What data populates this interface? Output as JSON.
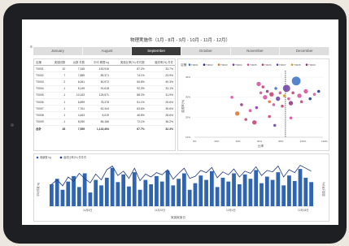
{
  "dashboard": {
    "title": "物理実施件（1月 - 8月 - 9月 - 10月 - 11月 - 12月）",
    "menu_icon": "≡",
    "months": [
      "January",
      "August",
      "September",
      "October",
      "November",
      "December"
    ],
    "active_month": "September"
  },
  "table": {
    "headers": [
      "店舗",
      "実施回数",
      "台数 件数",
      "平均 期間 kg",
      "実施比率(%) 件件数",
      "達成率(%) 件件"
    ],
    "rows": [
      [
        "T0001",
        "10",
        "7,345",
        "153,916",
        "87.2%",
        "33.7%"
      ],
      [
        "T0002",
        "7",
        "7,889",
        "85,371",
        "74.1%",
        "23.9%"
      ],
      [
        "T0003",
        "2",
        "6,061",
        "50,972",
        "50.8%",
        "49.3%"
      ],
      [
        "T0004",
        "1",
        "8,149",
        "91,618",
        "92.3%",
        "33.1%"
      ],
      [
        "T0005",
        "1",
        "10,163",
        "125,571",
        "88.2%",
        "31.9%"
      ],
      [
        "T0006",
        "1",
        "6,899",
        "78,378",
        "51.1%",
        "25.6%"
      ],
      [
        "T0007",
        "1",
        "7,761",
        "62,344",
        "63.6%",
        "35.6%"
      ],
      [
        "T0008",
        "1",
        "4,463",
        "6,019",
        "46.8%",
        "28.6%"
      ],
      [
        "T0009",
        "1",
        "8,090",
        "85,186",
        "72.1%",
        "36.2%"
      ]
    ],
    "total": [
      "合計",
      "48",
      "7,555",
      "1,142,494",
      "67.7%",
      "32.3%"
    ]
  },
  "scatter": {
    "legend_title": "店舗",
    "legend": [
      "T0001",
      "T0002",
      "T0003",
      "T0004",
      "T0005",
      "T0006",
      "T0007",
      "T0008",
      "T0009"
    ],
    "colors": [
      "#3a6fc4",
      "#1f2f7a",
      "#e0702f",
      "#7a3aa8",
      "#d44c9a",
      "#c43a6a",
      "#6a3fa0",
      "#c8a030",
      "#8f2f7a"
    ],
    "xlabel": "比率",
    "ylabel": "達成率(%)",
    "x_ticks": [
      "0%",
      "20%",
      "40%",
      "60%",
      "80%",
      "100%",
      "120%"
    ],
    "y_ticks": [
      "40%",
      "30%",
      "20%",
      "10%"
    ]
  },
  "combo": {
    "legend": [
      "実績数 kg",
      "達成比率(%) 件件件"
    ],
    "left_label": "平均件数 kg",
    "right_label": "達成比率(%)",
    "xlabel": "実施実施日",
    "date_labels": [
      "11月6日",
      "11月20日",
      "12月4日",
      "12月18日"
    ],
    "bar_color": "#2f64b0",
    "line_color": "#223a80"
  },
  "chart_data": [
    {
      "type": "table",
      "title": "",
      "columns": [
        "店舗",
        "実施回数",
        "台数 件数",
        "平均 期間 kg",
        "実施比率(%) 件件数",
        "達成率(%) 件件"
      ]
    },
    {
      "type": "scatter",
      "xlabel": "比率",
      "ylabel": "達成率(%)",
      "xlim": [
        0,
        120
      ],
      "ylim": [
        0,
        45
      ],
      "reference_line_x": 85,
      "points": [
        {
          "x": 60,
          "y": 36,
          "s": 3,
          "c": 4
        },
        {
          "x": 62,
          "y": 30,
          "s": 2,
          "c": 4
        },
        {
          "x": 64,
          "y": 34,
          "s": 2,
          "c": 5
        },
        {
          "x": 66,
          "y": 27,
          "s": 3,
          "c": 4
        },
        {
          "x": 68,
          "y": 31,
          "s": 2,
          "c": 8
        },
        {
          "x": 70,
          "y": 24,
          "s": 2,
          "c": 2
        },
        {
          "x": 72,
          "y": 29,
          "s": 3,
          "c": 5
        },
        {
          "x": 74,
          "y": 22,
          "s": 2,
          "c": 4
        },
        {
          "x": 76,
          "y": 33,
          "s": 2,
          "c": 0
        },
        {
          "x": 78,
          "y": 26,
          "s": 3,
          "c": 6
        },
        {
          "x": 80,
          "y": 30,
          "s": 2,
          "c": 4
        },
        {
          "x": 82,
          "y": 21,
          "s": 2,
          "c": 5
        },
        {
          "x": 84,
          "y": 28,
          "s": 2,
          "c": 7
        },
        {
          "x": 86,
          "y": 33,
          "s": 5,
          "c": 6
        },
        {
          "x": 88,
          "y": 26,
          "s": 2,
          "c": 4
        },
        {
          "x": 90,
          "y": 23,
          "s": 3,
          "c": 8
        },
        {
          "x": 92,
          "y": 30,
          "s": 2,
          "c": 5
        },
        {
          "x": 95,
          "y": 38,
          "s": 6,
          "c": 0
        },
        {
          "x": 98,
          "y": 28,
          "s": 3,
          "c": 4
        },
        {
          "x": 100,
          "y": 24,
          "s": 2,
          "c": 5
        },
        {
          "x": 104,
          "y": 31,
          "s": 3,
          "c": 4
        },
        {
          "x": 108,
          "y": 26,
          "s": 2,
          "c": 1
        },
        {
          "x": 112,
          "y": 29,
          "s": 2,
          "c": 4
        },
        {
          "x": 116,
          "y": 31,
          "s": 2,
          "c": 1
        },
        {
          "x": 40,
          "y": 16,
          "s": 3,
          "c": 2
        },
        {
          "x": 48,
          "y": 12,
          "s": 2,
          "c": 5
        },
        {
          "x": 52,
          "y": 18,
          "s": 2,
          "c": 4
        },
        {
          "x": 56,
          "y": 10,
          "s": 3,
          "c": 5
        },
        {
          "x": 58,
          "y": 20,
          "s": 2,
          "c": 3
        },
        {
          "x": 35,
          "y": 27,
          "s": 2,
          "c": 4
        },
        {
          "x": 44,
          "y": 22,
          "s": 2,
          "c": 8
        },
        {
          "x": 70,
          "y": 14,
          "s": 2,
          "c": 5
        },
        {
          "x": 90,
          "y": 13,
          "s": 2,
          "c": 4
        },
        {
          "x": 75,
          "y": 8,
          "s": 2,
          "c": 6
        }
      ]
    },
    {
      "type": "bar",
      "series": [
        {
          "name": "実績数 kg",
          "values": [
            40,
            50,
            30,
            45,
            55,
            35,
            60,
            25,
            48,
            38,
            52,
            70,
            44,
            58,
            36,
            62,
            30,
            48,
            40,
            55,
            45,
            65,
            38,
            50,
            60,
            30,
            42,
            56,
            48,
            64,
            35,
            52,
            45,
            60,
            40,
            58,
            50,
            66,
            42,
            54,
            48,
            62,
            38,
            56,
            46,
            68,
            52,
            44
          ]
        },
        {
          "name": "達成比率(%) 件件件",
          "values": [
            30,
            36,
            28,
            40,
            34,
            45,
            38,
            32,
            44,
            36,
            50,
            55,
            42,
            48,
            38,
            52,
            35,
            44,
            40,
            46,
            43,
            50,
            37,
            45,
            52,
            38,
            41,
            49,
            46,
            53,
            39,
            47,
            43,
            51,
            40,
            48,
            45,
            54,
            42,
            49,
            47,
            55,
            40,
            50,
            46,
            56,
            52,
            48
          ]
        }
      ],
      "ylim": [
        0,
        80
      ],
      "ylim_right": [
        0,
        60
      ]
    }
  ]
}
